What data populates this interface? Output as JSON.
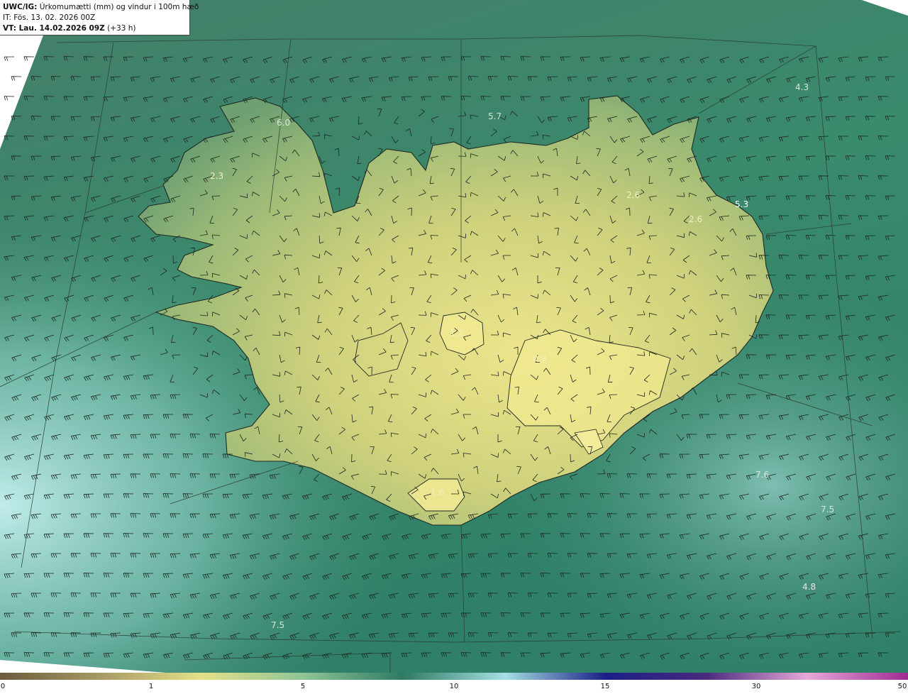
{
  "header": {
    "product": "UWC/IG:",
    "title": "Úrkomumætti (mm) og vindur i 100m hæð",
    "init_time": "IT: Fös. 13. 02. 2026 00Z",
    "valid_label": "VT: Lau. 14.02.2026 09Z",
    "lead_time": "(+33 h)"
  },
  "colorbar": {
    "ticks": [
      "0",
      "1",
      "5",
      "10",
      "15",
      "30",
      "50"
    ],
    "stops": [
      "#6b5a3c",
      "#a89a66",
      "#e6e088",
      "#8fc596",
      "#2f7a63",
      "#a6e0e3",
      "#1b1f86",
      "#4a2a7e",
      "#e7a7d8",
      "#a02a92"
    ]
  },
  "map": {
    "sea_color": "#3f8a6e",
    "land_color": "#d4d37e",
    "labels": [
      {
        "text": "6.0",
        "color": "#d8e6d8"
      },
      {
        "text": "5.7",
        "color": "#d8e6d8"
      },
      {
        "text": "4.3",
        "color": "#d8e6d8"
      },
      {
        "text": "2.3",
        "color": "#f0f0c0"
      },
      {
        "text": "2.6",
        "color": "#f0f0c0"
      },
      {
        "text": "2.6",
        "color": "#f0f0c0"
      },
      {
        "text": "5.3",
        "color": "#ffffff"
      },
      {
        "text": "1.2",
        "color": "#f0f0c0"
      },
      {
        "text": "0.9",
        "color": "#f0f0c0"
      },
      {
        "text": "7.6",
        "color": "#d8e6d8"
      },
      {
        "text": "7.5",
        "color": "#d8e6d8"
      },
      {
        "text": "1.6",
        "color": "#f0f0c0"
      },
      {
        "text": "4.8",
        "color": "#e8e8e8"
      },
      {
        "text": "7.5",
        "color": "#d8e6d8"
      }
    ]
  }
}
